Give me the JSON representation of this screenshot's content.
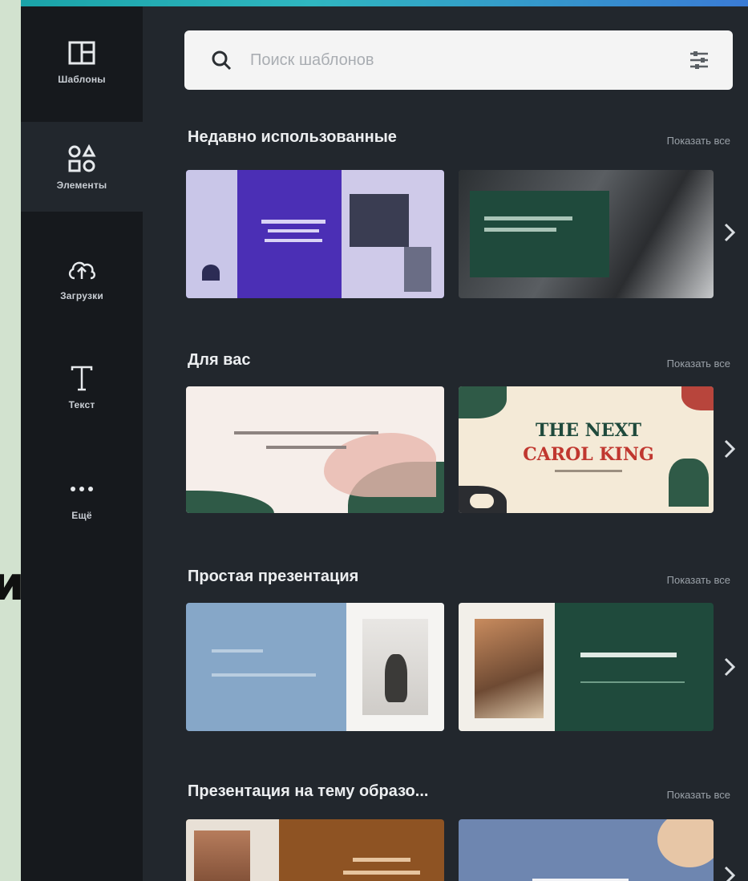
{
  "outside": {
    "partial_letter": "и"
  },
  "sidebar": {
    "items": [
      {
        "label": "Шаблоны",
        "icon": "templates-icon"
      },
      {
        "label": "Элементы",
        "icon": "elements-icon"
      },
      {
        "label": "Загрузки",
        "icon": "upload-cloud-icon"
      },
      {
        "label": "Текст",
        "icon": "text-icon"
      },
      {
        "label": "Ещё",
        "icon": "more-icon"
      }
    ]
  },
  "search": {
    "placeholder": "Поиск шаблонов",
    "icon": "search-icon",
    "filter_icon": "filter-icon"
  },
  "sections": [
    {
      "title": "Недавно использованные",
      "show_all": "Показать все",
      "cards": [
        {},
        {}
      ]
    },
    {
      "title": "Для вас",
      "show_all": "Показать все",
      "cards": [
        {},
        {
          "title_line1": "THE NEXT",
          "title_line2": "CAROL KING"
        }
      ]
    },
    {
      "title": "Простая презентация",
      "show_all": "Показать все",
      "cards": [
        {},
        {}
      ]
    },
    {
      "title": "Презентация на тему образо...",
      "show_all": "Показать все",
      "cards": [
        {},
        {}
      ]
    }
  ],
  "colors": {
    "panel_bg": "#22272d",
    "sidebar_bg": "#16191d",
    "accent_purple": "#4b2fb5",
    "accent_green": "#1f4a3c",
    "accent_red": "#c0372f",
    "slide_blue": "#86a7c8",
    "brown": "#8e5323"
  }
}
